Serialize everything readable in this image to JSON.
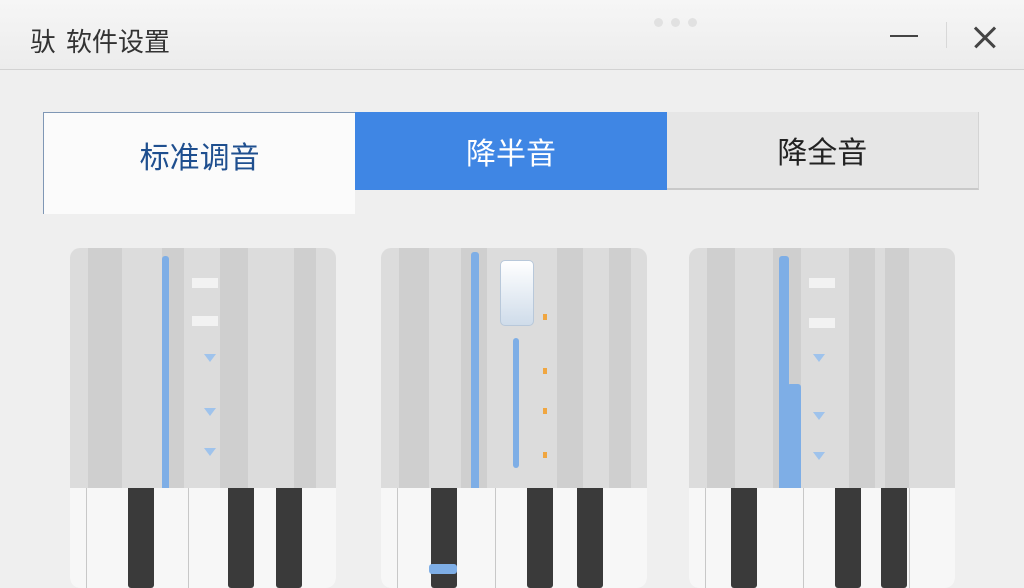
{
  "window": {
    "icon_glyph": "驮",
    "title": "软件设置",
    "icons": [
      "minimize-icon",
      "close-icon"
    ]
  },
  "tabs": [
    {
      "label": "标准调音",
      "state": "default"
    },
    {
      "label": "降半音",
      "state": "selected"
    },
    {
      "label": "降全音",
      "state": "default"
    }
  ],
  "colors": {
    "accent": "#3f86e4",
    "tab_text_default": "#1f4f8f",
    "background": "#efefef"
  }
}
